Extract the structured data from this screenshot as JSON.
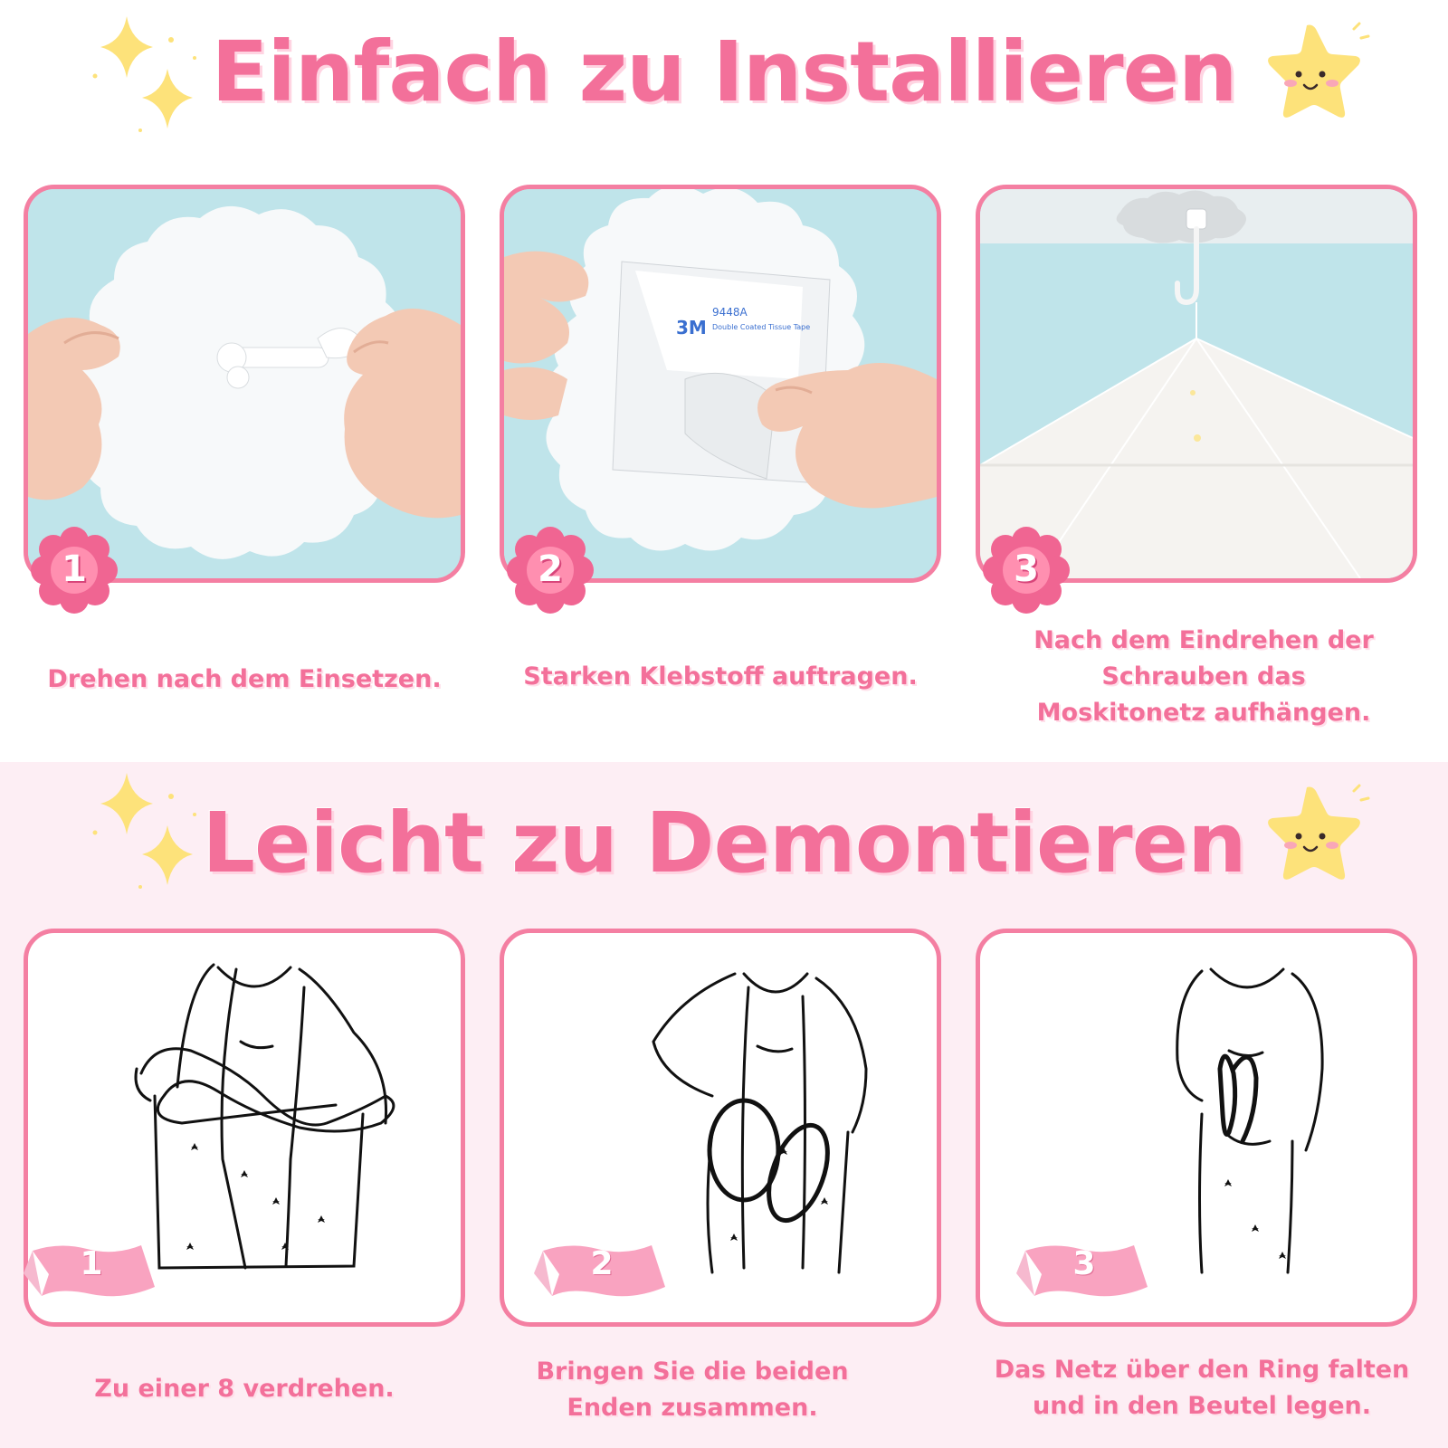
{
  "install": {
    "title": "Einfach zu Installieren",
    "steps": [
      {
        "number": "1",
        "caption": "Drehen nach dem Einsetzen."
      },
      {
        "number": "2",
        "caption": "Starken Klebstoff auftragen."
      },
      {
        "number": "3",
        "caption": "Nach dem Eindrehen der Schrauben das Moskitonetz aufhängen."
      }
    ]
  },
  "remove": {
    "title": "Leicht zu Demontieren",
    "steps": [
      {
        "number": "1",
        "caption": "Zu einer 8 verdrehen."
      },
      {
        "number": "2",
        "caption": "Bringen Sie die beiden Enden zusammen."
      },
      {
        "number": "3",
        "caption": "Das Netz über den Ring falten und in den Beutel legen."
      }
    ]
  },
  "tape_label": {
    "brand": "3M",
    "code": "9448A",
    "text": "Double Coated Tissue Tape"
  },
  "colors": {
    "accent_pink": "#f3709a",
    "card_border": "#f47fa2",
    "photo_bg": "#bfe4ea",
    "lower_bg": "#fdeef4",
    "star_yellow": "#fde27a"
  },
  "icons": [
    "sparkle-icon",
    "smiling-star-icon",
    "flower-badge-icon",
    "ribbon-badge-icon"
  ]
}
